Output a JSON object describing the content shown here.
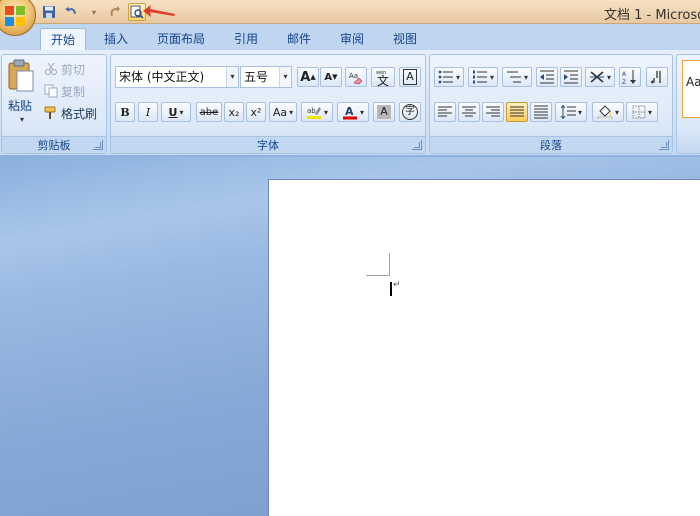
{
  "window": {
    "title": "文档 1 - Microso"
  },
  "tabs": [
    {
      "label": "开始",
      "active": true
    },
    {
      "label": "插入"
    },
    {
      "label": "页面布局"
    },
    {
      "label": "引用"
    },
    {
      "label": "邮件"
    },
    {
      "label": "审阅"
    },
    {
      "label": "视图"
    }
  ],
  "clipboard": {
    "paste": "粘贴",
    "cut": "剪切",
    "copy": "复制",
    "format_painter": "格式刷",
    "label": "剪贴板"
  },
  "font": {
    "family": "宋体 (中文正文)",
    "size": "五号",
    "label": "字体",
    "bold": "B",
    "italic": "I",
    "underline": "U",
    "strike": "abe",
    "subscript": "x₂",
    "superscript": "x²",
    "change_case": "Aa",
    "grow": "A",
    "shrink": "A",
    "phonetic": "文",
    "border_char": "A",
    "shade_char": "A",
    "enclose": "字",
    "highlight_color": "#f5e400",
    "font_color": "#e00000"
  },
  "paragraph": {
    "label": "段落"
  },
  "styles": {
    "preview": "Aa"
  },
  "icons": {
    "office": "office-logo-icon",
    "save": "save-icon",
    "undo": "undo-icon",
    "redo": "redo-icon",
    "print_preview": "print-preview-icon"
  }
}
